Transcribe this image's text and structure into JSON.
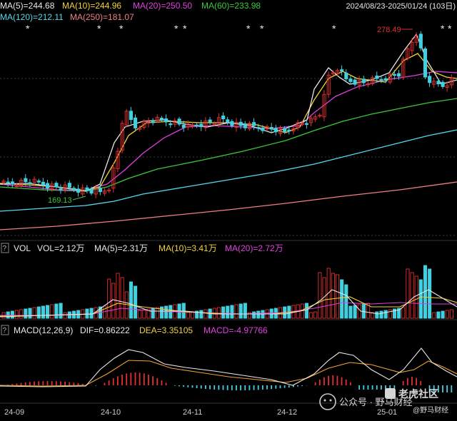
{
  "header": {
    "ma_labels": [
      {
        "text": "MA(5)=244.68",
        "color": "#e8e8e8"
      },
      {
        "text": "MA(10)=244.96",
        "color": "#f2d23a"
      },
      {
        "text": "MA(20)=250.50",
        "color": "#e040e0"
      },
      {
        "text": "MA(60)=233.98",
        "color": "#3cc83c"
      }
    ],
    "ma_labels_row2": [
      {
        "text": "MA(120)=212.11",
        "color": "#56d8e8"
      },
      {
        "text": "MA(250)=181.07",
        "color": "#f08080"
      }
    ],
    "date_range": "2024/08/23-2025/01/24 (103日)",
    "max_label": "278.49",
    "min_label": "169.13"
  },
  "volume_panel": {
    "help": "?",
    "title": "VOL",
    "vol": "VOL=2.12万",
    "ma5": "MA(5)=2.31万",
    "ma10": "MA(10)=3.41万",
    "ma20": "MA(20)=2.72万"
  },
  "macd_panel": {
    "help": "?",
    "title": "MACD(12,26,9)",
    "dif": "DIF=0.86222",
    "dea": "DEA=3.35105",
    "macd": "MACD=-4.97766"
  },
  "x_axis": [
    "24-09",
    "24-10",
    "24-11",
    "24-12",
    "25-01"
  ],
  "watermark": {
    "account": "公众号 · 野马财经",
    "brand": "老虎社区",
    "brand_sub": "@野马财经"
  },
  "colors": {
    "up": "#e03030",
    "down": "#40d0e0",
    "ma5": "#e8e8e8",
    "ma10": "#f2d23a",
    "ma20": "#e040e0",
    "ma60": "#3cc83c",
    "ma120": "#56d8e8",
    "ma250": "#f08080"
  }
}
